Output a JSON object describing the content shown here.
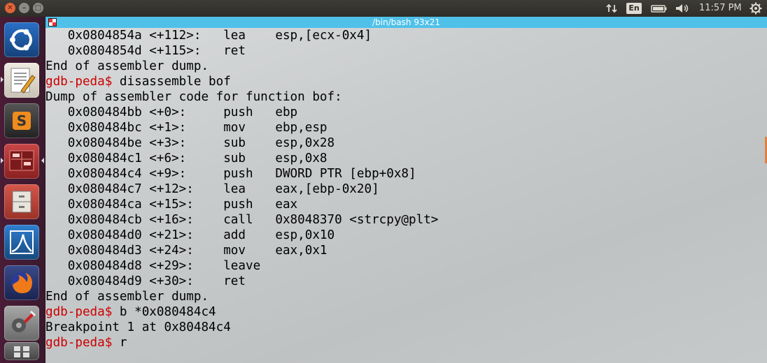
{
  "topbar": {
    "window_buttons": [
      "close",
      "minimize",
      "maximize"
    ],
    "tray": {
      "network_icon": "network-updown-icon",
      "language": "En",
      "battery_icon": "battery-icon",
      "volume_icon": "volume-icon",
      "clock": "11:57 PM",
      "settings_icon": "gear-icon"
    }
  },
  "launcher": {
    "items": [
      {
        "name": "ubuntu-dash",
        "icon": "ubuntu-logo-icon",
        "color": "#1b5fa8"
      },
      {
        "name": "text-editor",
        "icon": "text-editor-icon",
        "color": "#d8d4cc"
      },
      {
        "name": "sublime-text",
        "icon": "sublime-icon",
        "color": "#3a3a3a"
      },
      {
        "name": "terminal",
        "icon": "terminal-icon",
        "color": "#b83a3a"
      },
      {
        "name": "file-manager",
        "icon": "file-cabinet-icon",
        "color": "#c84a3a"
      },
      {
        "name": "wireshark",
        "icon": "wireshark-fin-icon",
        "color": "#2a6fbf"
      },
      {
        "name": "firefox",
        "icon": "firefox-icon",
        "color": "#e66000"
      },
      {
        "name": "system-settings",
        "icon": "settings-tools-icon",
        "color": "#9a9a9a"
      },
      {
        "name": "workspaces",
        "icon": "workspace-icon",
        "color": "#666"
      }
    ]
  },
  "terminal": {
    "title": "/bin/bash 93x21",
    "lines": [
      {
        "type": "asm",
        "text": "   0x0804854a <+112>:   lea    esp,[ecx-0x4]"
      },
      {
        "type": "asm",
        "text": "   0x0804854d <+115>:   ret"
      },
      {
        "type": "out",
        "text": "End of assembler dump."
      },
      {
        "type": "cmd",
        "prompt": "gdb-peda$",
        "text": " disassemble bof"
      },
      {
        "type": "out",
        "text": "Dump of assembler code for function bof:"
      },
      {
        "type": "asm",
        "text": "   0x080484bb <+0>:     push   ebp"
      },
      {
        "type": "asm",
        "text": "   0x080484bc <+1>:     mov    ebp,esp"
      },
      {
        "type": "asm",
        "text": "   0x080484be <+3>:     sub    esp,0x28"
      },
      {
        "type": "asm",
        "text": "   0x080484c1 <+6>:     sub    esp,0x8"
      },
      {
        "type": "asm",
        "text": "   0x080484c4 <+9>:     push   DWORD PTR [ebp+0x8]"
      },
      {
        "type": "asm",
        "text": "   0x080484c7 <+12>:    lea    eax,[ebp-0x20]"
      },
      {
        "type": "asm",
        "text": "   0x080484ca <+15>:    push   eax"
      },
      {
        "type": "asm",
        "text": "   0x080484cb <+16>:    call   0x8048370 <strcpy@plt>"
      },
      {
        "type": "asm",
        "text": "   0x080484d0 <+21>:    add    esp,0x10"
      },
      {
        "type": "asm",
        "text": "   0x080484d3 <+24>:    mov    eax,0x1"
      },
      {
        "type": "asm",
        "text": "   0x080484d8 <+29>:    leave"
      },
      {
        "type": "asm",
        "text": "   0x080484d9 <+30>:    ret"
      },
      {
        "type": "out",
        "text": "End of assembler dump."
      },
      {
        "type": "cmd",
        "prompt": "gdb-peda$",
        "text": " b *0x080484c4"
      },
      {
        "type": "out",
        "text": "Breakpoint 1 at 0x80484c4"
      },
      {
        "type": "cmd",
        "prompt": "gdb-peda$",
        "text": " r"
      }
    ]
  }
}
